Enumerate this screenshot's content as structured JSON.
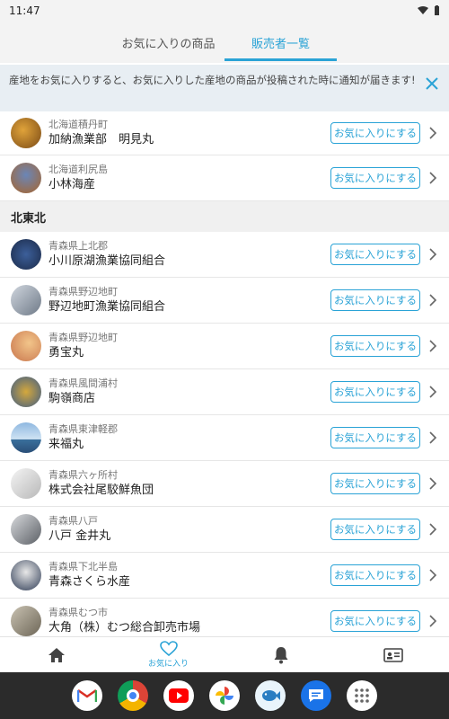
{
  "status_bar": {
    "time": "11:47"
  },
  "tabs": [
    {
      "label": "お気に入りの商品",
      "active": false
    },
    {
      "label": "販売者一覧",
      "active": true
    }
  ],
  "notice": {
    "text": "産地をお気に入りすると、お気に入りした産地の商品が投稿された時に通知が届きます!"
  },
  "fav_button_label": "お気に入りにする",
  "top_rows": [
    {
      "region": "北海道積丹町",
      "name": "加納漁業部　明見丸"
    },
    {
      "region": "北海道利尻島",
      "name": "小林海産"
    }
  ],
  "section_tohoku": {
    "label": "北東北"
  },
  "tohoku_rows": [
    {
      "region": "青森県上北郡",
      "name": "小川原湖漁業協同組合"
    },
    {
      "region": "青森県野辺地町",
      "name": "野辺地町漁業協同組合"
    },
    {
      "region": "青森県野辺地町",
      "name": "勇宝丸"
    },
    {
      "region": "青森県風間浦村",
      "name": "駒嶺商店"
    },
    {
      "region": "青森県東津軽郡",
      "name": "来福丸"
    },
    {
      "region": "青森県六ヶ所村",
      "name": "株式会社尾駮鮮魚団"
    },
    {
      "region": "青森県八戸",
      "name": "八戸 金井丸"
    },
    {
      "region": "青森県下北半島",
      "name": "青森さくら水産"
    },
    {
      "region": "青森県むつ市",
      "name": "大角（株）むつ総合卸売市場"
    }
  ],
  "bottom_nav": {
    "favorites_label": "お気に入り"
  },
  "colors": {
    "accent": "#2aa3d6"
  }
}
